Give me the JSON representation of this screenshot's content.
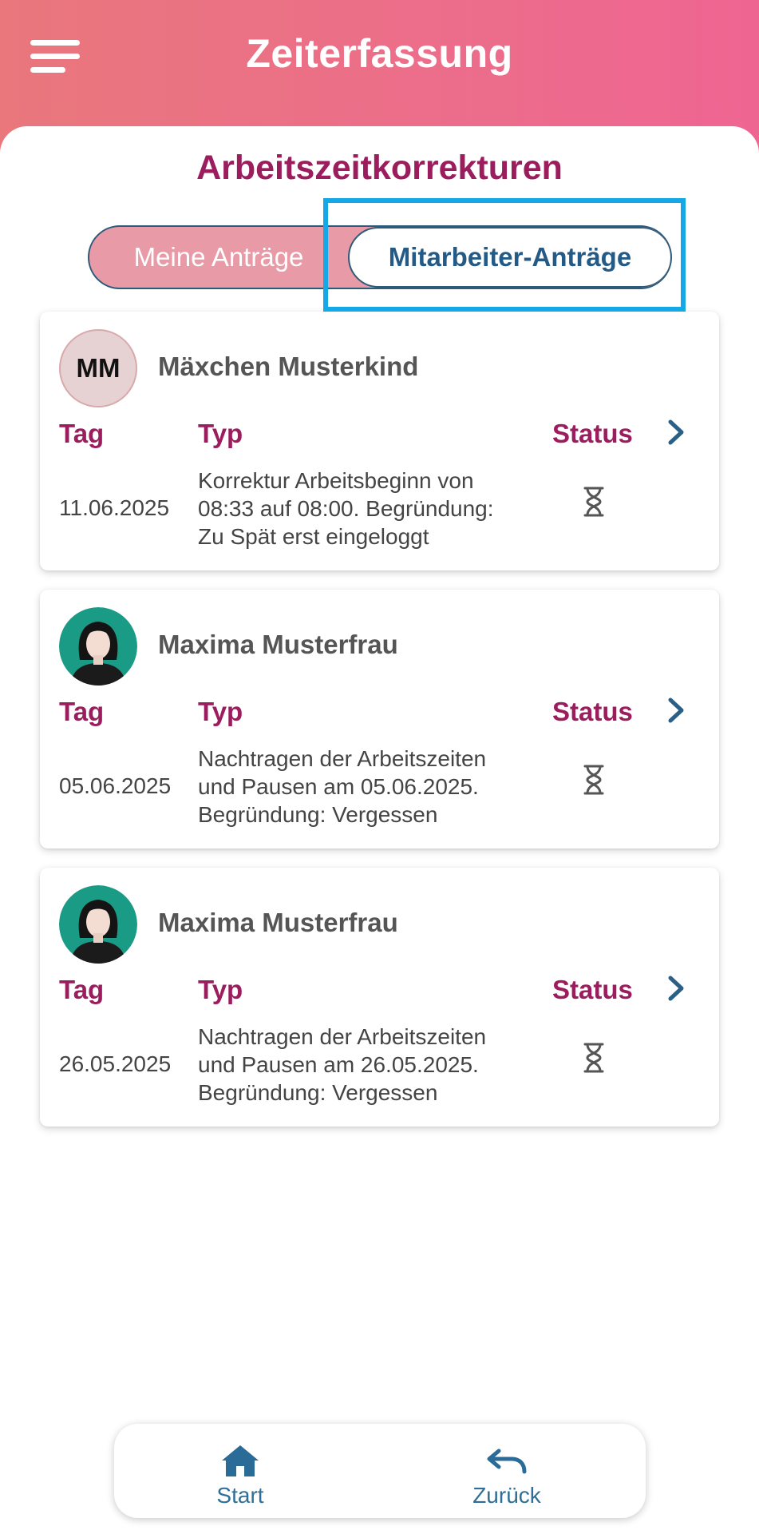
{
  "header": {
    "title": "Zeiterfassung",
    "menu_icon": "menu-icon"
  },
  "page": {
    "title": "Arbeitszeitkorrekturen"
  },
  "tabs": {
    "own": "Meine Anträge",
    "employees": "Mitarbeiter-Anträge",
    "active": "employees"
  },
  "columns": {
    "day": "Tag",
    "type": "Typ",
    "status": "Status"
  },
  "requests": [
    {
      "name": "Mäxchen Musterkind",
      "initials": "MM",
      "avatar": "initials",
      "date": "11.06.2025",
      "type_lines": [
        "Korrektur Arbeitsbeginn von",
        "08:33 auf 08:00. Begründung:",
        "Zu Spät erst eingeloggt"
      ],
      "status_icon": "hourglass-icon"
    },
    {
      "name": "Maxima Musterfrau",
      "avatar": "female-avatar",
      "date": "05.06.2025",
      "type_lines": [
        "Nachtragen der Arbeitszeiten",
        "und Pausen am 05.06.2025.",
        "Begründung: Vergessen"
      ],
      "status_icon": "hourglass-icon"
    },
    {
      "name": "Maxima Musterfrau",
      "avatar": "female-avatar",
      "date": "26.05.2025",
      "type_lines": [
        "Nachtragen der Arbeitszeiten",
        "und Pausen am 26.05.2025.",
        "Begründung: Vergessen"
      ],
      "status_icon": "hourglass-icon"
    }
  ],
  "bottom_nav": {
    "start": "Start",
    "back": "Zurück"
  },
  "colors": {
    "accent": "#9b1d5d",
    "nav_blue": "#2f6f97",
    "highlight": "#14a9e6"
  }
}
